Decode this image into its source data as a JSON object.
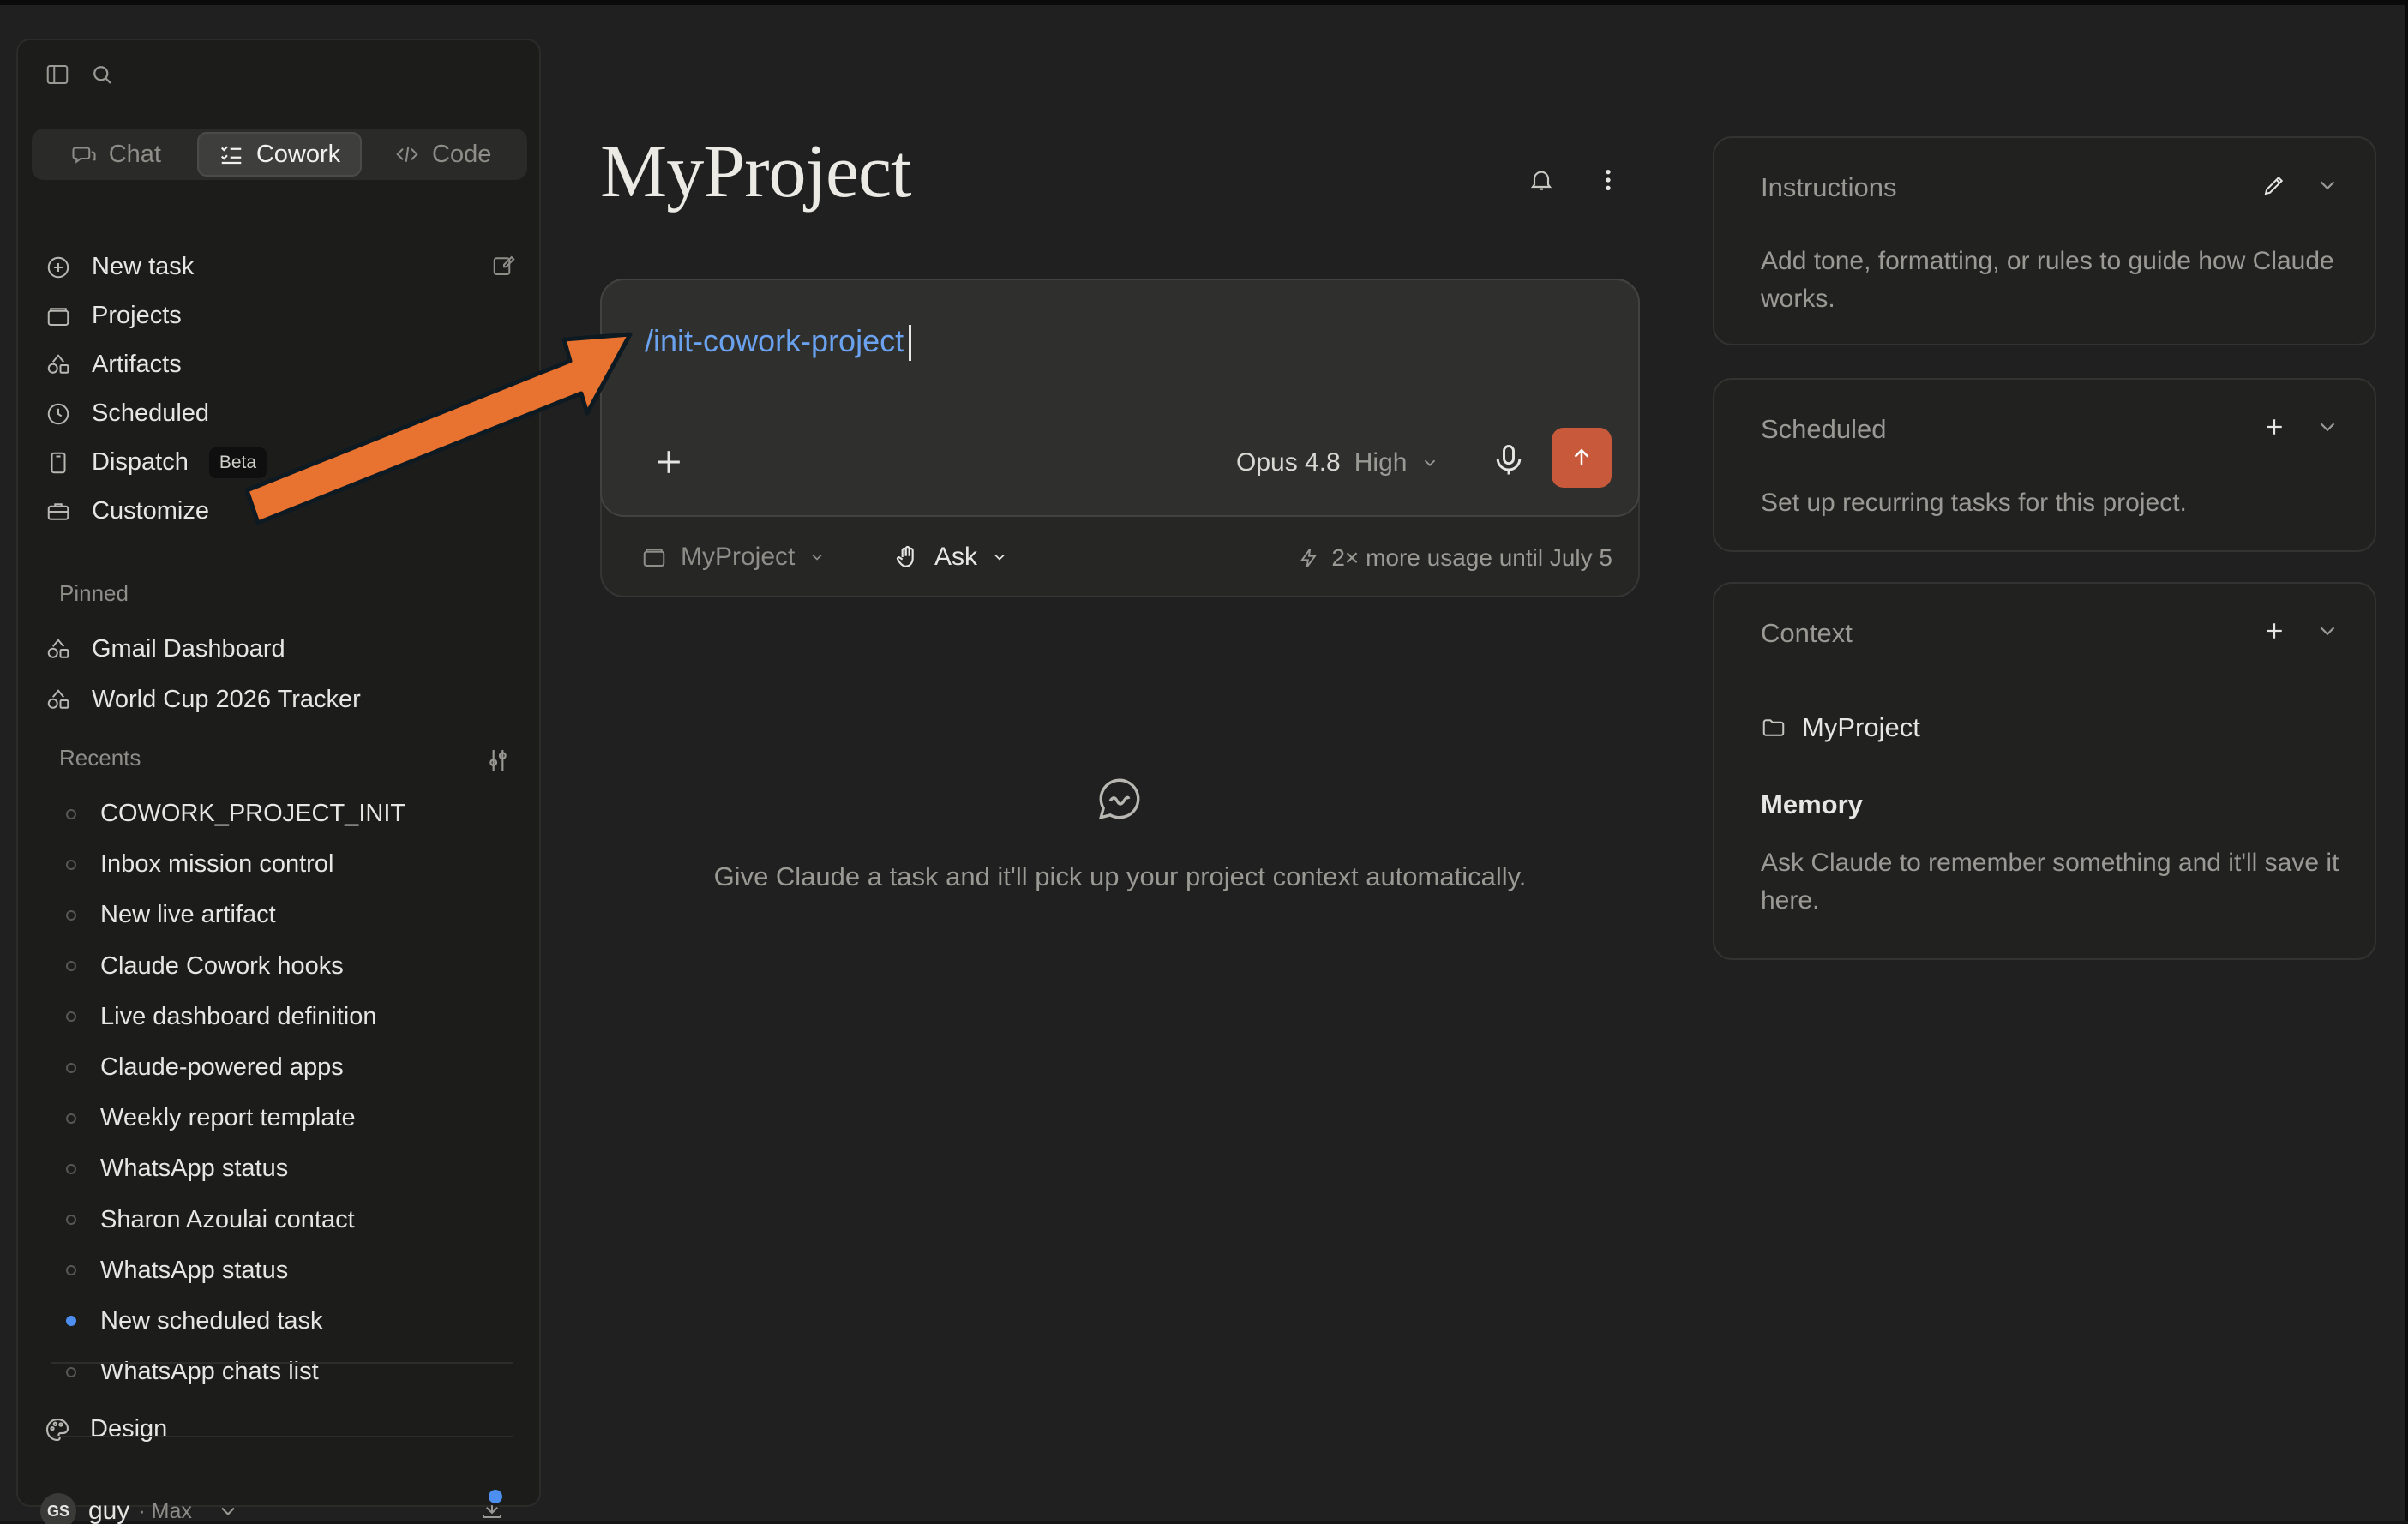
{
  "sidebar": {
    "modes": [
      {
        "label": "Chat",
        "icon": "chat-bubble-icon"
      },
      {
        "label": "Cowork",
        "icon": "checklist-icon",
        "active": true
      },
      {
        "label": "Code",
        "icon": "code-icon"
      }
    ],
    "nav": [
      {
        "label": "New task",
        "icon": "plus-circle-icon"
      },
      {
        "label": "Projects",
        "icon": "folder-icon"
      },
      {
        "label": "Artifacts",
        "icon": "artifacts-icon"
      },
      {
        "label": "Scheduled",
        "icon": "clock-icon"
      },
      {
        "label": "Dispatch",
        "icon": "phone-icon",
        "badge": "Beta"
      },
      {
        "label": "Customize",
        "icon": "briefcase-icon"
      }
    ],
    "pinned_label": "Pinned",
    "pinned": [
      {
        "label": "Gmail Dashboard"
      },
      {
        "label": "World Cup 2026 Tracker"
      }
    ],
    "recents_label": "Recents",
    "recents": [
      {
        "label": "COWORK_PROJECT_INIT"
      },
      {
        "label": "Inbox mission control"
      },
      {
        "label": "New live artifact"
      },
      {
        "label": "Claude Cowork hooks"
      },
      {
        "label": "Live dashboard definition"
      },
      {
        "label": "Claude-powered apps"
      },
      {
        "label": "Weekly report template"
      },
      {
        "label": "WhatsApp status"
      },
      {
        "label": "Sharon Azoulai contact"
      },
      {
        "label": "WhatsApp status"
      },
      {
        "label": "New scheduled task",
        "active": true
      },
      {
        "label": "WhatsApp chats list"
      }
    ],
    "design_label": "Design",
    "user": {
      "initials": "GS",
      "name": "guy",
      "plan": "· Max"
    }
  },
  "main": {
    "title": "MyProject",
    "composer": {
      "slash": "/",
      "command": "init-cowork-project",
      "model": "Opus 4.8",
      "effort": "High",
      "project": "MyProject",
      "mode": "Ask",
      "usage_note": "2× more usage until July 5"
    },
    "empty_state": "Give Claude a task and it'll pick up your project context automatically."
  },
  "right_panel": {
    "instructions": {
      "title": "Instructions",
      "body": "Add tone, formatting, or rules to guide how Claude works."
    },
    "scheduled": {
      "title": "Scheduled",
      "body": "Set up recurring tasks for this project."
    },
    "context": {
      "title": "Context",
      "folder": "MyProject",
      "memory_title": "Memory",
      "memory_body": "Ask Claude to remember something and it'll save it here."
    }
  },
  "colors": {
    "accent_send": "#c8593b",
    "annotation_arrow": "#e8722f",
    "command_text": "#6aa2f0",
    "active_dot": "#4c8ff0"
  }
}
